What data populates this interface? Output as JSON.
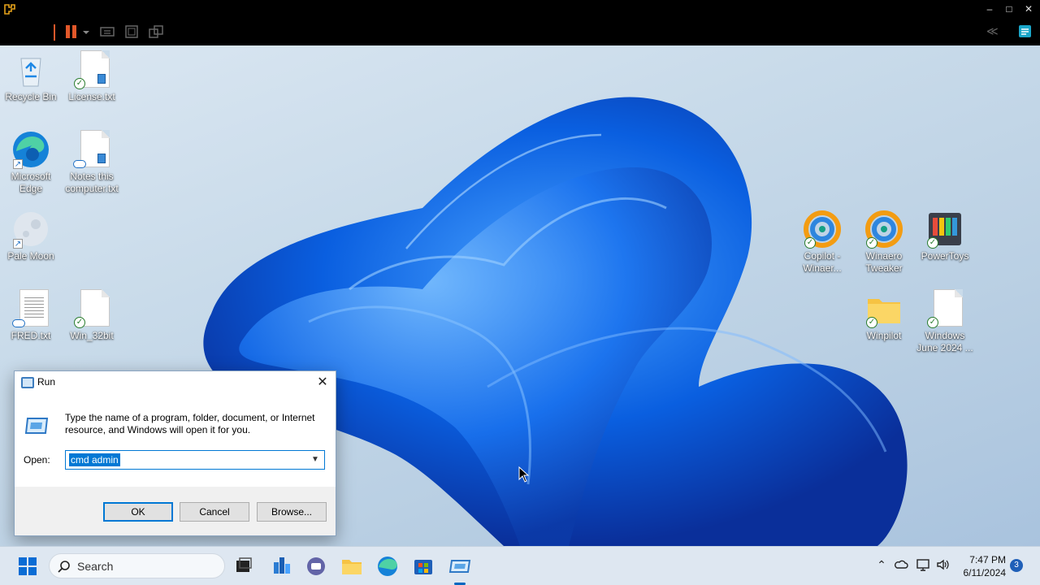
{
  "desktop": {
    "icons": [
      {
        "label": "Recycle Bin"
      },
      {
        "label": "License.txt"
      },
      {
        "label": "Microsoft Edge"
      },
      {
        "label": "Notes this computer.txt"
      },
      {
        "label": "Pale Moon"
      },
      {
        "label": "FRED.txt"
      },
      {
        "label": "Win_32bit"
      },
      {
        "label": "Copilot - Winaer..."
      },
      {
        "label": "Winaero Tweaker"
      },
      {
        "label": "PowerToys"
      },
      {
        "label": "Winpilot"
      },
      {
        "label": "Windows June 2024 ..."
      }
    ]
  },
  "run_dialog": {
    "title": "Run",
    "description": "Type the name of a program, folder, document, or Internet resource, and Windows will open it for you.",
    "open_label": "Open:",
    "open_value": "cmd admin",
    "ok_label": "OK",
    "cancel_label": "Cancel",
    "browse_label": "Browse..."
  },
  "taskbar": {
    "search_placeholder": "Search",
    "time": "7:47 PM",
    "date": "6/11/2024",
    "notification_count": "3"
  },
  "colors": {
    "accent": "#0078d4",
    "taskbar_bg": "#dee7f1",
    "vm_chrome": "#000000"
  }
}
